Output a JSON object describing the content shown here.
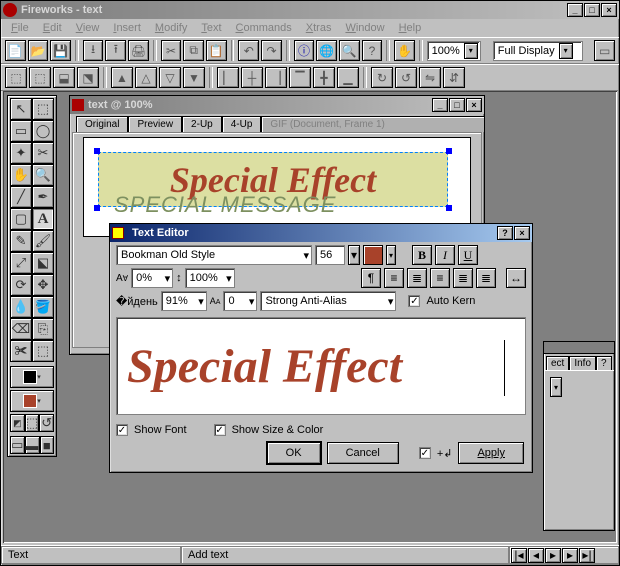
{
  "app": {
    "title": "Fireworks - text"
  },
  "menu": {
    "file": "File",
    "edit": "Edit",
    "view": "View",
    "insert": "Insert",
    "modify": "Modify",
    "text": "Text",
    "commands": "Commands",
    "xtras": "Xtras",
    "window": "Window",
    "help": "Help"
  },
  "main_toolbar": {
    "zoom_value": "100%",
    "display_mode": "Full Display",
    "icons": [
      "new-icon",
      "open-icon",
      "save-icon",
      "import-icon",
      "export-icon",
      "print-icon",
      "cut-icon",
      "copy-icon",
      "paste-icon",
      "undo-icon",
      "redo-icon",
      "info-icon",
      "globe-icon",
      "zoom-icon",
      "help-icon",
      "hand-icon"
    ]
  },
  "second_toolbar": {
    "icons": [
      "group-icon",
      "ungroup-icon",
      "layer-forward-icon",
      "layer-backward-icon",
      "layer-front-icon",
      "layer-back-icon",
      "align-left-icon",
      "align-center-icon",
      "align-right-icon",
      "align-top-icon",
      "align-middle-icon",
      "align-bottom-icon",
      "rotate-cw-icon",
      "rotate-ccw-icon",
      "flip-h-icon",
      "flip-v-icon"
    ]
  },
  "tools": {
    "items": [
      "pointer-tool",
      "subselect-tool",
      "marquee-tool",
      "lasso-tool",
      "magic-wand-tool",
      "crop-tool",
      "hand-tool",
      "zoom-tool",
      "line-tool",
      "pen-tool",
      "rectangle-tool",
      "text-tool",
      "pencil-tool",
      "brush-tool",
      "scale-tool",
      "skew-tool",
      "freeform-tool",
      "reshape-tool",
      "eyedropper-tool",
      "paint-bucket-tool",
      "eraser-tool",
      "rubber-stamp-tool",
      "knife-tool",
      "hotspot-tool"
    ],
    "glyphs": [
      "↖",
      "⬚",
      "▭",
      "◯",
      "✦",
      "✂",
      "✋",
      "🔍",
      "╱",
      "✒",
      "▢",
      "A",
      "✎",
      "🖌",
      "⤢",
      "⬕",
      "⟳",
      "✥",
      "💧",
      "🪣",
      "⌫",
      "⎘",
      "✀",
      "⬚"
    ],
    "stroke_color": "#000000",
    "fill_color": "#a8422a"
  },
  "document": {
    "title": "text @ 100%",
    "tabs": [
      "Original",
      "Preview",
      "2-Up",
      "4-Up"
    ],
    "gif_label": "GIF (Document, Frame 1)",
    "text_main": "Special Effect",
    "text_shadow": "SPECIAL MESSAGE"
  },
  "text_editor": {
    "title": "Text Editor",
    "font": "Bookman Old Style",
    "size": "56",
    "fill_hex": "#a8422a",
    "bold": "B",
    "italic": "I",
    "underline": "U",
    "av_label": "AV",
    "av_value": "0%",
    "leading_value": "100%",
    "baseline_value": "91%",
    "aa_shift_label": "AA",
    "aa_shift_value": "0",
    "antialias": "Strong Anti-Alias",
    "autokern": "Auto Kern",
    "preview": "Special Effect",
    "show_font": "Show Font",
    "show_size": "Show Size & Color",
    "ok": "OK",
    "cancel": "Cancel",
    "apply": "Apply"
  },
  "panel": {
    "tabs": [
      "ect",
      "Info"
    ],
    "tab_close": "?"
  },
  "status": {
    "left": "Text",
    "right": "Add text"
  }
}
